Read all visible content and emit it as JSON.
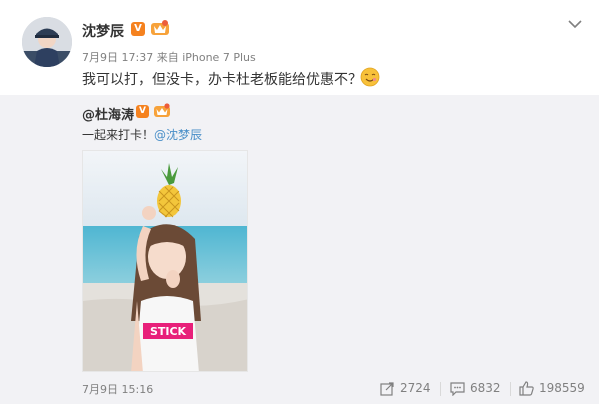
{
  "post": {
    "author": "沈梦辰",
    "meta_time": "7月9日 17:37",
    "meta_source": "来自 iPhone 7 Plus",
    "content": "我可以打，但没卡，办卡杜老板能给优惠不？",
    "verified_badge": "V",
    "badge_color": "#f5821f"
  },
  "repost": {
    "author": "@杜海涛",
    "verified_badge": "V",
    "text_prefix": "一起来打卡！",
    "mention": "@沈梦辰",
    "timestamp": "7月9日 15:16",
    "photo_print_text": "STICK",
    "actions": {
      "repost_count": "2724",
      "comment_count": "6832",
      "like_count": "198559"
    },
    "icons": [
      "share-icon",
      "comment-icon",
      "like-icon"
    ]
  },
  "colors": {
    "repost_bg": "#f2f2f5",
    "link": "#4a8fc8",
    "muted": "#808080"
  }
}
